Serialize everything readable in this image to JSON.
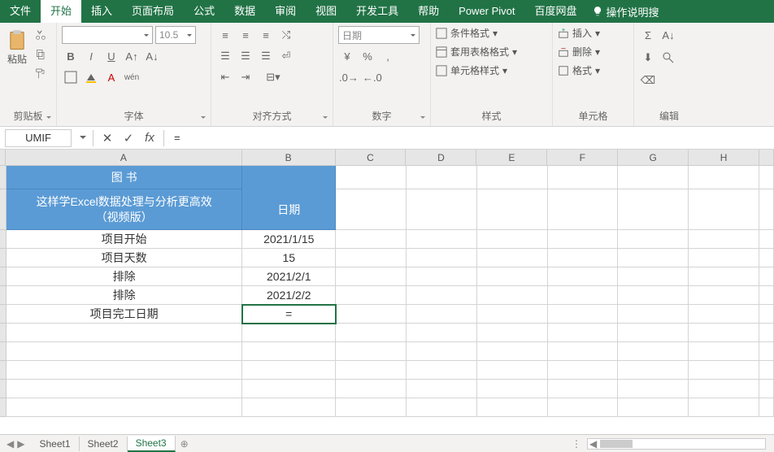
{
  "tabs": {
    "file": "文件",
    "home": "开始",
    "insert": "插入",
    "layout": "页面布局",
    "formula": "公式",
    "data": "数据",
    "review": "审阅",
    "view": "视图",
    "dev": "开发工具",
    "help": "帮助",
    "power": "Power Pivot",
    "baidu": "百度网盘",
    "search": "操作说明搜"
  },
  "ribbon": {
    "clipboard_label": "剪贴板",
    "font_label": "字体",
    "align_label": "对齐方式",
    "number_label": "数字",
    "styles_label": "样式",
    "cells_label": "单元格",
    "editing_label": "编辑",
    "font_name": "",
    "font_size": "10.5",
    "number_fmt": "日期",
    "cond_fmt": "条件格式",
    "table_fmt": "套用表格格式",
    "cell_fmt": "单元格样式",
    "insert_btn": "插入",
    "delete_btn": "删除",
    "format_btn": "格式"
  },
  "namebox": "UMIF",
  "formula": "=",
  "columns": [
    "A",
    "B",
    "C",
    "D",
    "E",
    "F",
    "G",
    "H",
    ""
  ],
  "sheet_data": {
    "header_a_line1": "图 书",
    "header_a_line2": "这样学Excel数据处理与分析更高效",
    "header_a_line3": "（视频版）",
    "header_b": "日期",
    "rows": [
      {
        "a": "项目开始",
        "b": "2021/1/15"
      },
      {
        "a": "项目天数",
        "b": "15"
      },
      {
        "a": "排除",
        "b": "2021/2/1"
      },
      {
        "a": "排除",
        "b": "2021/2/2"
      },
      {
        "a": "项目完工日期",
        "b": "="
      }
    ]
  },
  "sheets": [
    "Sheet1",
    "Sheet2",
    "Sheet3"
  ],
  "active_sheet": "Sheet3",
  "sigma": "Σ"
}
